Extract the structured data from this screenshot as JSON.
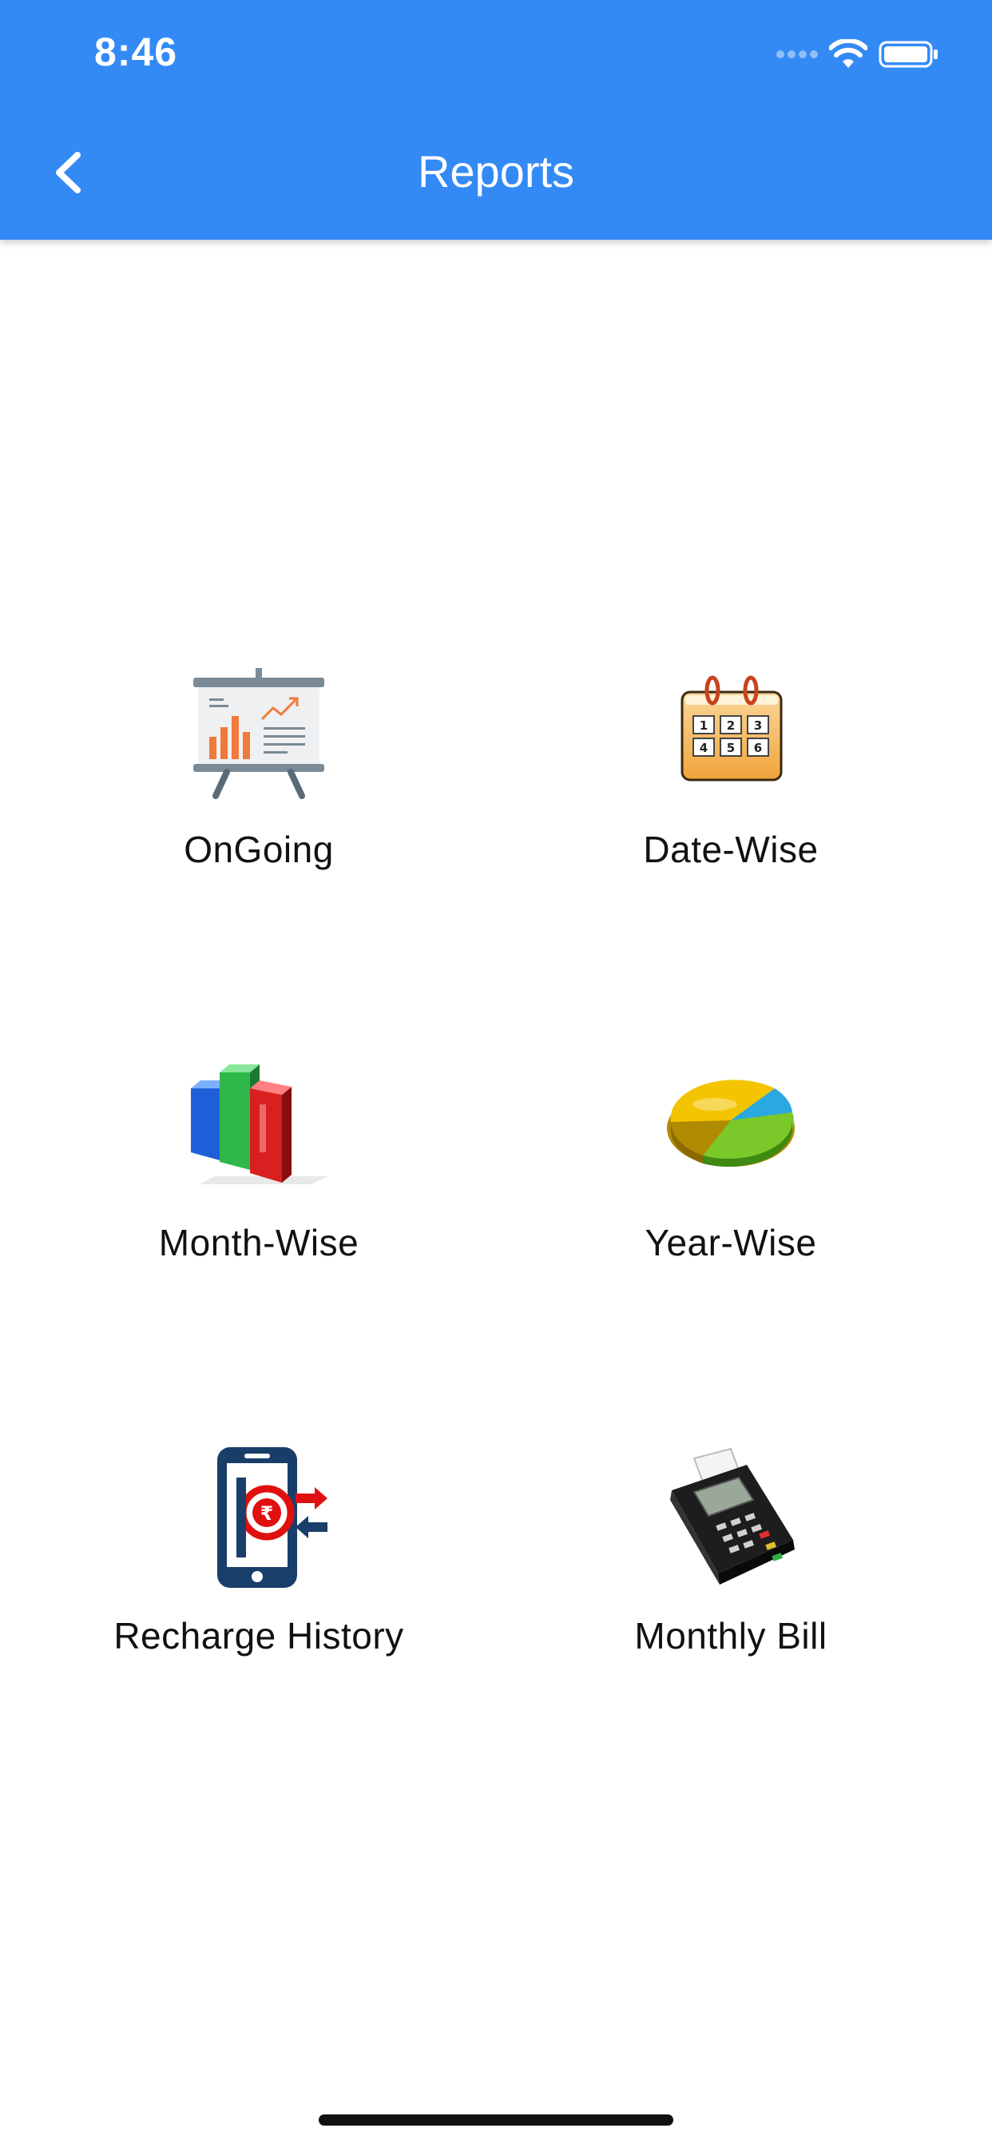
{
  "status_bar": {
    "time": "8:46"
  },
  "header": {
    "title": "Reports",
    "back_icon": "chevron-left-icon"
  },
  "colors": {
    "header_bg": "#338af5",
    "text": "#111111"
  },
  "tiles": [
    {
      "label": "OnGoing",
      "icon": "presentation-chart-icon"
    },
    {
      "label": "Date-Wise",
      "icon": "calendar-icon"
    },
    {
      "label": "Month-Wise",
      "icon": "bar-chart-3d-icon"
    },
    {
      "label": "Year-Wise",
      "icon": "pie-chart-3d-icon"
    },
    {
      "label": "Recharge History",
      "icon": "mobile-rupee-icon"
    },
    {
      "label": "Monthly Bill",
      "icon": "card-machine-icon"
    }
  ]
}
